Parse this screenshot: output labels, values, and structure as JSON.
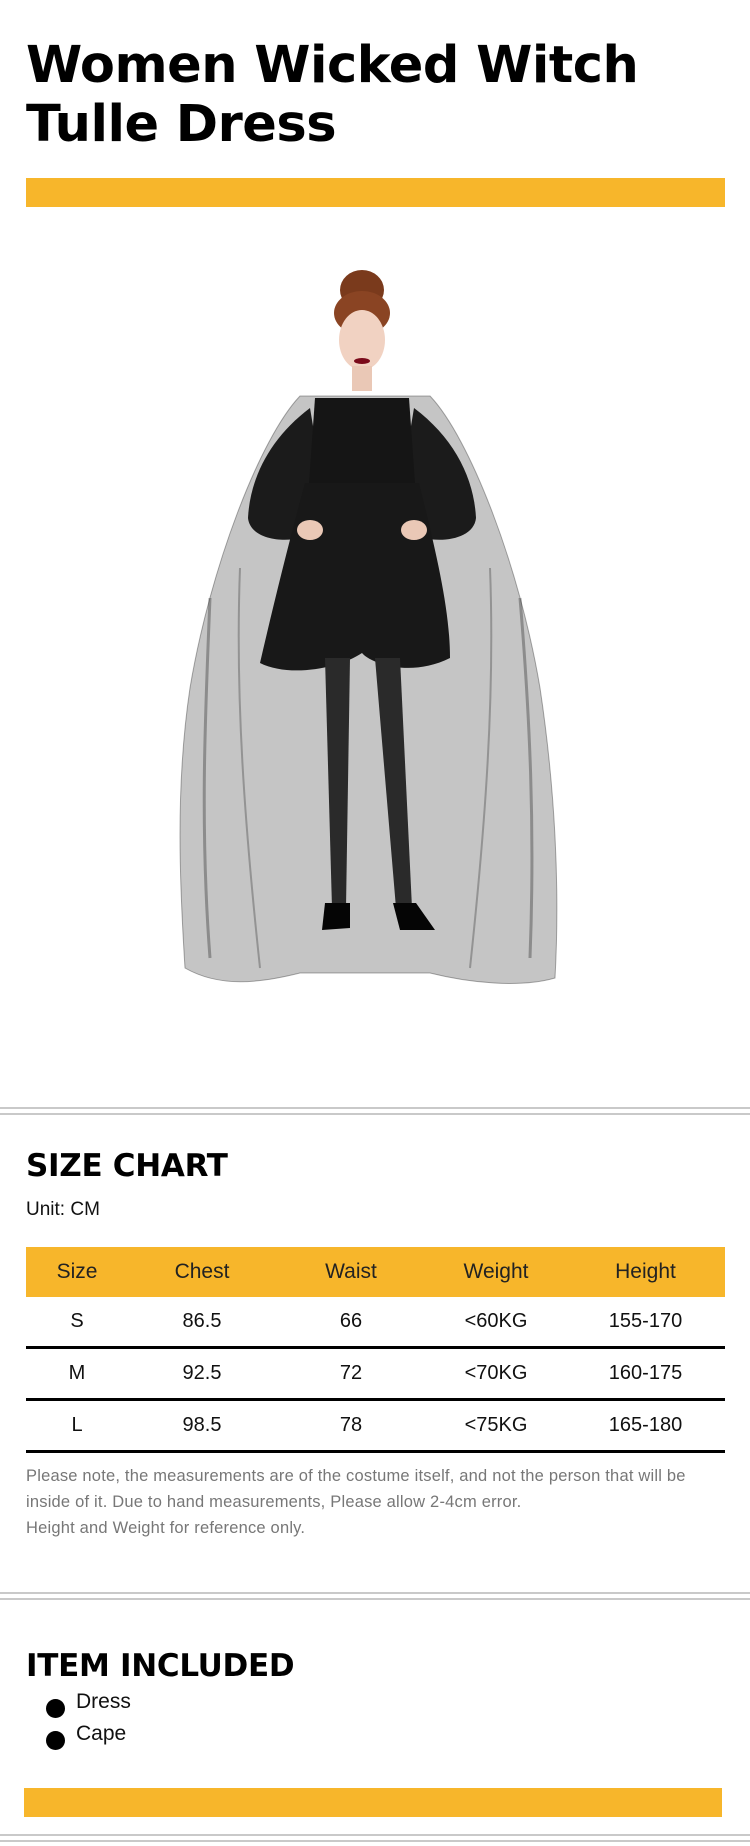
{
  "product": {
    "title": "Women Wicked Witch Tulle Dress"
  },
  "size_chart": {
    "heading": "SIZE CHART",
    "unit": "Unit: CM",
    "headers": [
      "Size",
      "Chest",
      "Waist",
      "Weight",
      "Height"
    ],
    "rows": [
      [
        "S",
        "86.5",
        "66",
        "<60KG",
        "155-170"
      ],
      [
        "M",
        "92.5",
        "72",
        "<70KG",
        "160-175"
      ],
      [
        "L",
        "98.5",
        "78",
        "<75KG",
        "165-180"
      ]
    ],
    "note_line1": "Please note, the measurements are of the costume itself, and not the person that will be inside of it. Due to hand measurements, Please allow 2-4cm error.",
    "note_line2": "Height and Weight for reference only."
  },
  "items_included": {
    "heading": "ITEM INCLUDED",
    "items": [
      "Dress",
      "Cape"
    ]
  },
  "colors": {
    "accent": "#f7b62b",
    "divider": "#c9c9c9",
    "note_text": "#777777"
  }
}
